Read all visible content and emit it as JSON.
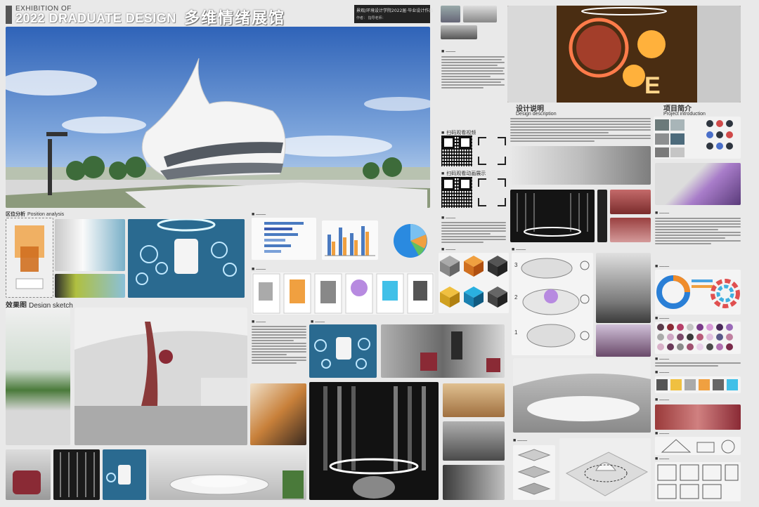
{
  "header": {
    "subtitle": "EXHIBITION OF",
    "title": "2022 DRADUATE DESIGN",
    "title_cn": "多维情绪展馆",
    "info_line1": "景观/环境设计学院2022届·毕业设计作品",
    "info_line2": "作者：  指导老师：  ",
    "accent": "#555555"
  },
  "sections": {
    "position": {
      "cn": "区位分析",
      "en": "Position analysis"
    },
    "sketch": {
      "cn": "效果图",
      "en": "Design sketch"
    },
    "design_desc": {
      "cn": "设计说明",
      "en": "Design description"
    },
    "project_intro": {
      "cn": "项目简介",
      "en": "Project introduction"
    },
    "scan1": {
      "cn": "扫码观看视频"
    },
    "scan2": {
      "cn": "扫码观看动画展示"
    }
  },
  "icons": [
    "qr-code-icon",
    "scan-frame-icon"
  ],
  "colors": {
    "sky": "#4d7fc4",
    "building": "#f2f2f2",
    "cyan": "#1fa6d8",
    "orange": "#e8902c",
    "purple": "#b78ae0",
    "wine": "#8a2a35"
  }
}
